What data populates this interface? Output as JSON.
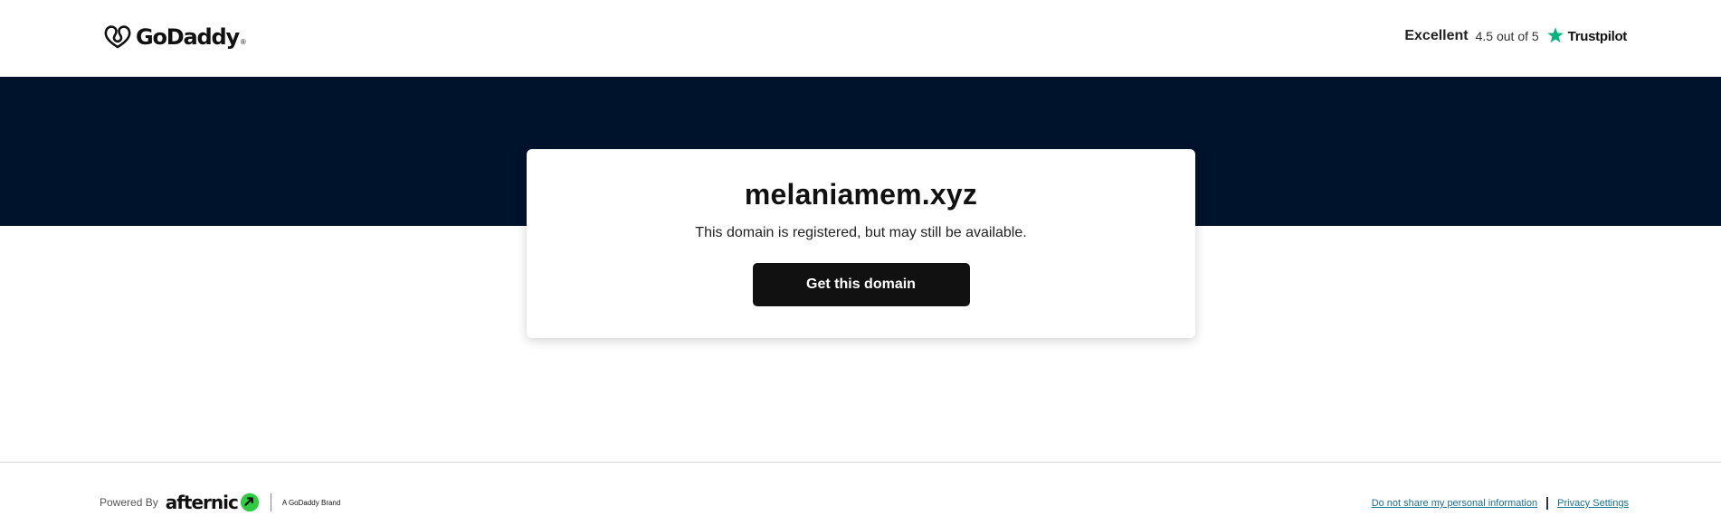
{
  "header": {
    "logo_text": "GoDaddy",
    "logo_tm": "®",
    "trust": {
      "excellent": "Excellent",
      "rating": "4.5 out of 5",
      "brand": "Trustpilot",
      "star_color": "#00b67a"
    }
  },
  "colors": {
    "band": "#00132c",
    "button": "#111111",
    "afternic_green": "#2ecc40"
  },
  "card": {
    "domain": "melaniamem.xyz",
    "subtitle": "This domain is registered, but may still be available.",
    "button_label": "Get this domain"
  },
  "footer": {
    "powered_by": "Powered By",
    "afternic_text": "afternic",
    "brand_note": "A GoDaddy Brand",
    "links": {
      "do_not_share": "Do not share my personal information",
      "privacy": "Privacy Settings"
    }
  }
}
